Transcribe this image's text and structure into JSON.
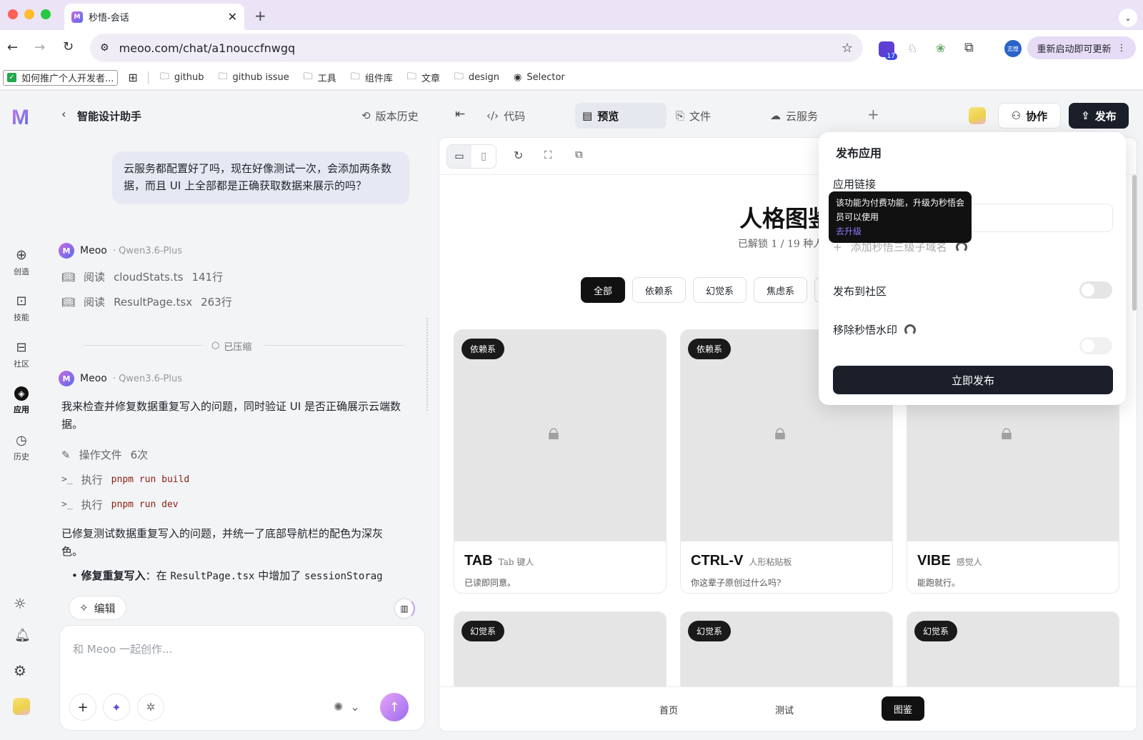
{
  "browser": {
    "tab_title": "秒悟-会话",
    "url": "meoo.com/chat/a1nouccfnwgq",
    "update_label": "重新启动即可更新",
    "ext_badge": "17",
    "profile_label": "志煌",
    "bookmarks": [
      "如何推广个人开发者...",
      "github",
      "github issue",
      "工具",
      "组件库",
      "文章",
      "design",
      "Selector"
    ]
  },
  "nav": {
    "items": [
      {
        "label": "创造",
        "icon": "plus-circle-icon"
      },
      {
        "label": "技能",
        "icon": "skill-icon"
      },
      {
        "label": "社区",
        "icon": "community-icon"
      },
      {
        "label": "应用",
        "icon": "app-cube-icon"
      },
      {
        "label": "历史",
        "icon": "clock-icon"
      }
    ]
  },
  "header": {
    "title": "智能设计助手",
    "version_history": "版本历史",
    "tabs": [
      "代码",
      "预览",
      "文件",
      "云服务"
    ],
    "active_tab": "预览",
    "collab": "协作",
    "publish": "发布"
  },
  "chat": {
    "user_message": "云服务都配置好了吗，现在好像测试一次，会添加两条数据，而且 UI 上全部都是正确获取数据来展示的吗？",
    "agent_name": "Meoo",
    "model": "Qwen3.6-Plus",
    "reads": [
      {
        "verb": "阅读",
        "file": "cloudStats.ts",
        "lines": "141行"
      },
      {
        "verb": "阅读",
        "file": "ResultPage.tsx",
        "lines": "263行"
      }
    ],
    "compressed": "已压缩",
    "reply_intro": "我来检查并修复数据重复写入的问题，同时验证 UI 是否正确展示云端数据。",
    "ops": {
      "verb": "操作文件",
      "count": "6次"
    },
    "cmds": [
      {
        "verb": "执行",
        "cmd": "pnpm run build"
      },
      {
        "verb": "执行",
        "cmd": "pnpm run dev"
      }
    ],
    "summary": "已修复测试数据重复写入的问题，并统一了底部导航栏的配色为深灰色。",
    "bullet_bold": "修复重复写入",
    "bullet_text": "：在",
    "bullet_code1": "ResultPage.tsx",
    "bullet_mid": "中增加了",
    "bullet_code2": "sessionStorag",
    "edit_label": "编辑",
    "placeholder": "和 Meoo 一起创作..."
  },
  "preview": {
    "page_title": "人格图鉴",
    "unlock_text": "已解锁 1 / 19 种人",
    "filters": [
      "全部",
      "依赖系",
      "幻觉系",
      "焦虑系"
    ],
    "cards": [
      {
        "tag": "依赖系",
        "name": "TAB",
        "sub": "Tab 键人",
        "desc": "已读即同意。"
      },
      {
        "tag": "依赖系",
        "name": "CTRL-V",
        "sub": "人形粘贴板",
        "desc": "你这辈子原创过什么吗?"
      },
      {
        "tag": "",
        "name": "VIBE",
        "sub": "感觉人",
        "desc": "能跑就行。"
      },
      {
        "tag": "幻觉系"
      },
      {
        "tag": "幻觉系"
      },
      {
        "tag": "幻觉系"
      }
    ],
    "bottom_nav": [
      "首页",
      "测试",
      "图鉴"
    ],
    "bottom_active": "图鉴"
  },
  "publish_panel": {
    "title": "发布应用",
    "link_label": "应用链接",
    "tooltip_text": "该功能为付费功能，升级为秒悟会员可以使用",
    "tooltip_link": "去升级",
    "add_domain": "添加秒悟三级子域名",
    "community_label": "发布到社区",
    "community_on": false,
    "watermark_label": "移除秒悟水印",
    "watermark_on": false,
    "submit": "立即发布"
  },
  "colors": {
    "primary_dark": "#1b1f2a",
    "accent_purple": "#a86cf0",
    "link": "#8b7bff"
  }
}
